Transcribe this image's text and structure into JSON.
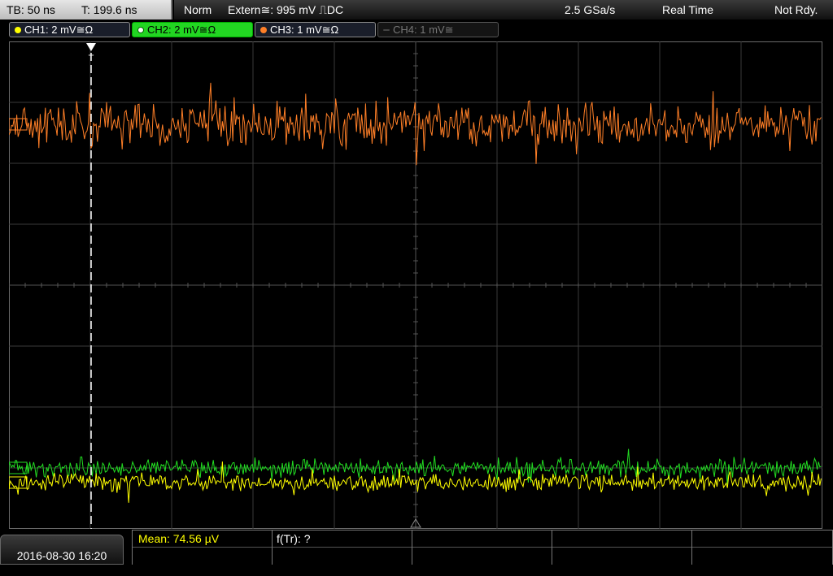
{
  "topbar": {
    "timebase": "TB: 50 ns",
    "trigger_time": "T: 199.6 ns",
    "trigger_mode": "Norm",
    "trigger_source": "Extern≅: 995 mV ⎍DC",
    "sample_rate": "2.5 GSa/s",
    "acq_mode": "Real Time",
    "status": "Not Rdy."
  },
  "channels": [
    {
      "label": "CH1: 2 mV≅Ω",
      "color": "#ffff00"
    },
    {
      "label": "CH2: 2 mV≅Ω",
      "color": "#22dd22"
    },
    {
      "label": "CH3: 1 mV≅Ω",
      "color": "#ff7f27"
    },
    {
      "label": "CH4: 1 mV≅",
      "color": "#777777"
    }
  ],
  "measurements": {
    "mean": "Mean: 74.56 µV",
    "ftr": "f(Tr): ?"
  },
  "datetime": "2016-08-30 16:20",
  "trigger_marker": "T",
  "colors": {
    "ch1": "#ffff00",
    "ch2": "#22dd22",
    "ch3": "#ff7f27",
    "grid": "#3a3a3a"
  }
}
